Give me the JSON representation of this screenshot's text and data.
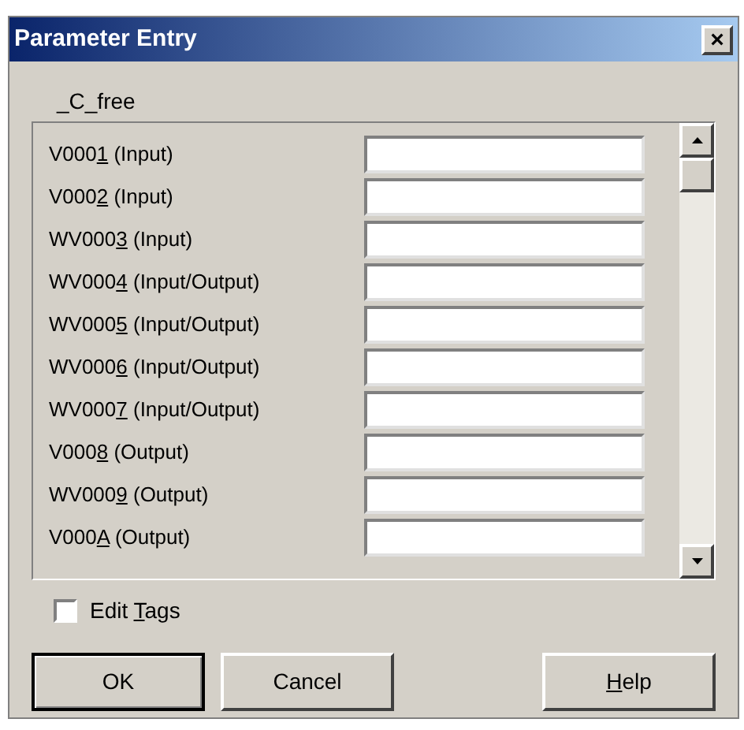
{
  "window": {
    "title": "Parameter Entry",
    "close": "×"
  },
  "group_label": "_C_free",
  "parameters": [
    {
      "before": "V000",
      "key": "1",
      "after": " (Input)"
    },
    {
      "before": "V000",
      "key": "2",
      "after": " (Input)"
    },
    {
      "before": "WV000",
      "key": "3",
      "after": " (Input)"
    },
    {
      "before": "WV000",
      "key": "4",
      "after": " (Input/Output)"
    },
    {
      "before": "WV000",
      "key": "5",
      "after": " (Input/Output)"
    },
    {
      "before": "WV000",
      "key": "6",
      "after": " (Input/Output)"
    },
    {
      "before": "WV000",
      "key": "7",
      "after": " (Input/Output)"
    },
    {
      "before": "V000",
      "key": "8",
      "after": " (Output)"
    },
    {
      "before": "WV000",
      "key": "9",
      "after": " (Output)"
    },
    {
      "before": "V000",
      "key": "A",
      "after": " (Output)"
    }
  ],
  "edit_tags": {
    "before": "Edit ",
    "key": "T",
    "after": "ags",
    "checked": false
  },
  "buttons": [
    {
      "before": "OK",
      "default": true
    },
    {
      "before": "Cancel",
      "default": false
    },
    {
      "key": "H",
      "after": "elp",
      "default": false
    }
  ]
}
